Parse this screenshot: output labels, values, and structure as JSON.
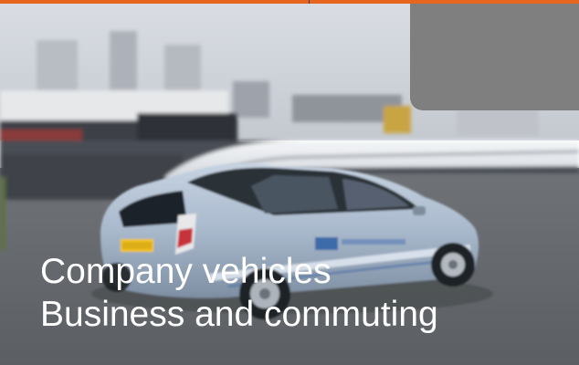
{
  "slide": {
    "caption": {
      "line1": "Company vehicles",
      "line2": "Business and commuting"
    },
    "photo_icon": "car-photo",
    "colors": {
      "top_bar": "#e5661c",
      "placeholder_box": "#7f7f7f",
      "caption_text": "#ffffff"
    }
  }
}
